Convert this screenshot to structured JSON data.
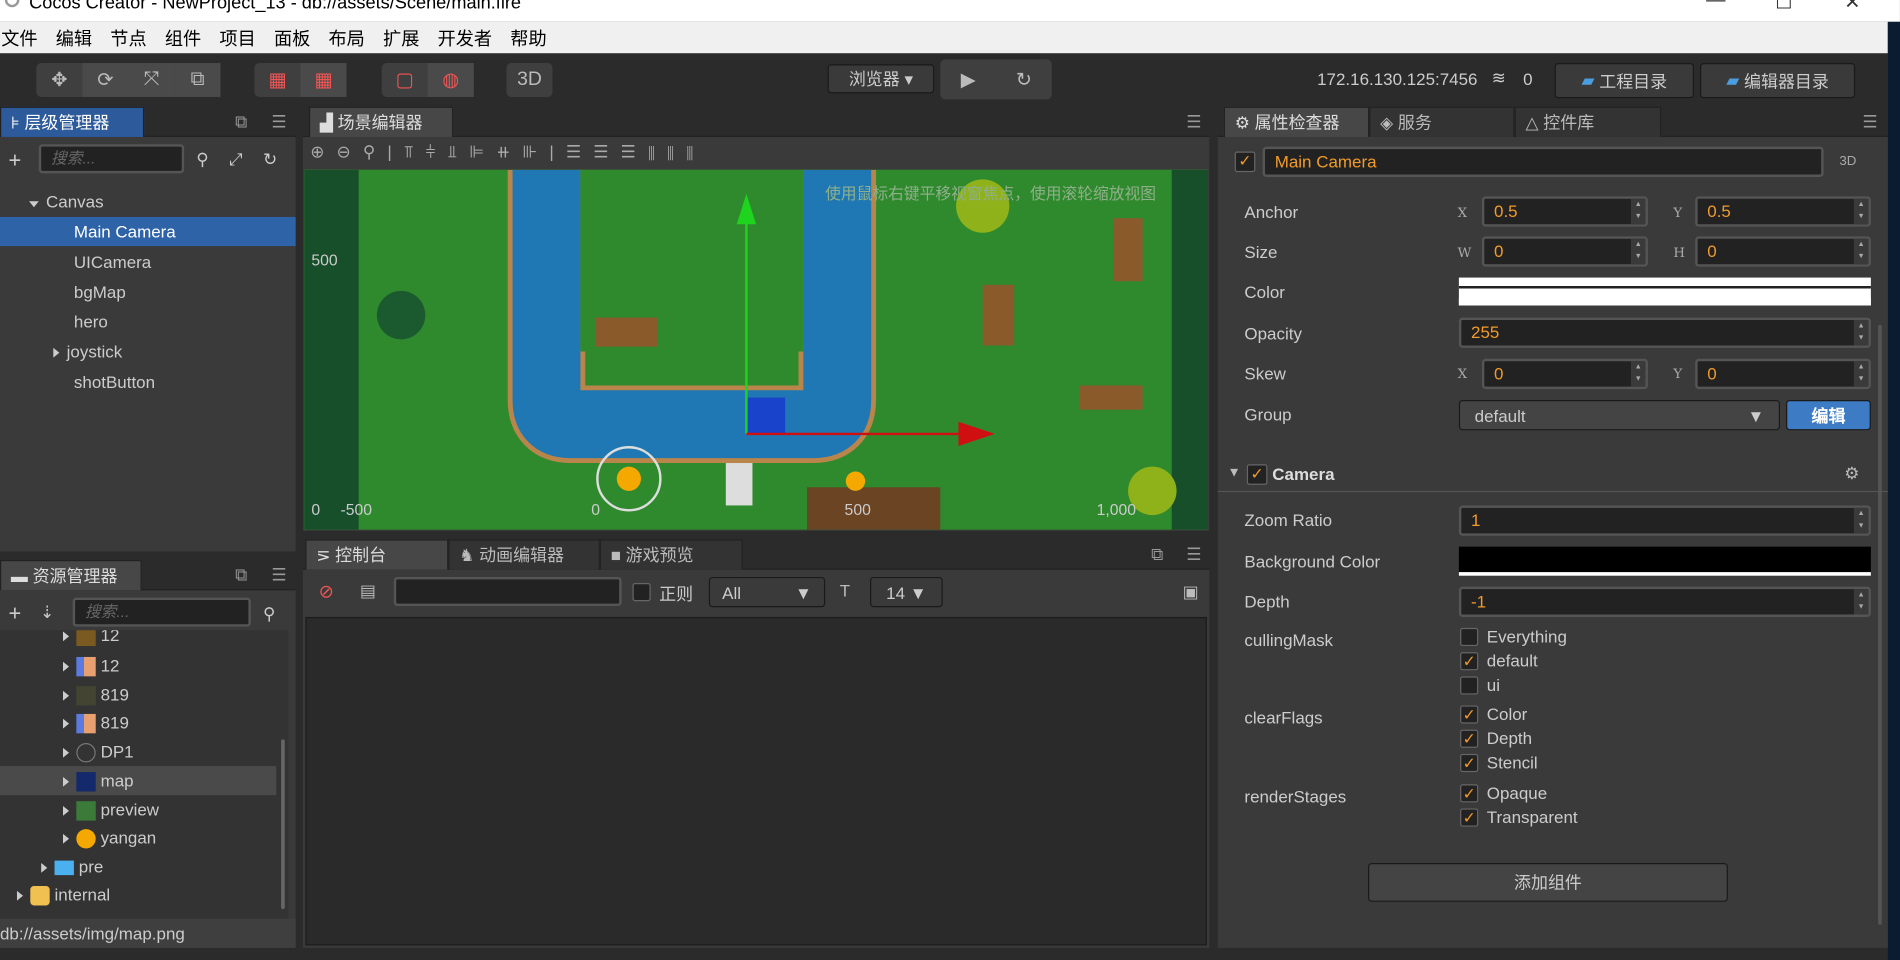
{
  "window": {
    "title": "Cocos Creator - NewProject_13 - db://assets/Scene/main.fire"
  },
  "menu": [
    "文件",
    "编辑",
    "节点",
    "组件",
    "项目",
    "面板",
    "布局",
    "扩展",
    "开发者",
    "帮助"
  ],
  "toolbar": {
    "three_d": "3D",
    "browser": "浏览器",
    "ip": "172.16.130.125:7456",
    "connections": "0",
    "project_dir": "工程目录",
    "editor_dir": "编辑器目录"
  },
  "hierarchy": {
    "title": "层级管理器",
    "search_placeholder": "搜索...",
    "root": "Canvas",
    "children": [
      "Main Camera",
      "UICamera",
      "bgMap",
      "hero",
      "joystick",
      "shotButton"
    ]
  },
  "assets": {
    "title": "资源管理器",
    "search_placeholder": "搜索...",
    "items": [
      "12",
      "12",
      "819",
      "819",
      "DP1",
      "map",
      "preview",
      "yangan"
    ],
    "folder": "pre",
    "internal": "internal",
    "status": "db://assets/img/map.png"
  },
  "scene": {
    "title": "场景编辑器",
    "hint": "使用鼠标右键平移视窗焦点，使用滚轮缩放视图",
    "y_labels": [
      "500",
      "-500"
    ],
    "x_labels": [
      "0",
      "0",
      "500",
      "1,000"
    ]
  },
  "console": {
    "tabs": [
      "控制台",
      "动画编辑器",
      "游戏预览"
    ],
    "regex_label": "正则",
    "level": "All",
    "font_size": "14"
  },
  "inspector": {
    "tabs": [
      "属性检查器",
      "服务",
      "控件库"
    ],
    "node_name": "Main Camera",
    "mode": "3D",
    "anchor": {
      "label": "Anchor",
      "x": "0.5",
      "y": "0.5"
    },
    "size": {
      "label": "Size",
      "w": "0",
      "h": "0"
    },
    "color": {
      "label": "Color",
      "value": "#ffffff"
    },
    "opacity": {
      "label": "Opacity",
      "value": "255"
    },
    "skew": {
      "label": "Skew",
      "x": "0",
      "y": "0"
    },
    "group": {
      "label": "Group",
      "value": "default",
      "edit": "编辑"
    },
    "camera": {
      "title": "Camera",
      "zoom_label": "Zoom Ratio",
      "zoom": "1",
      "bg_label": "Background Color",
      "bg": "#000000",
      "depth_label": "Depth",
      "depth": "-1",
      "culling_label": "cullingMask",
      "culling": [
        {
          "label": "Everything",
          "checked": false
        },
        {
          "label": "default",
          "checked": true
        },
        {
          "label": "ui",
          "checked": false
        }
      ],
      "clear_label": "clearFlags",
      "clear": [
        {
          "label": "Color",
          "checked": true
        },
        {
          "label": "Depth",
          "checked": true
        },
        {
          "label": "Stencil",
          "checked": true
        }
      ],
      "render_label": "renderStages",
      "render": [
        {
          "label": "Opaque",
          "checked": true
        },
        {
          "label": "Transparent",
          "checked": true
        }
      ]
    },
    "add_component": "添加组件"
  },
  "colors": {
    "accent": "#f29b2a",
    "selection": "#2f63a8",
    "button_blue": "#3d7cc4"
  }
}
